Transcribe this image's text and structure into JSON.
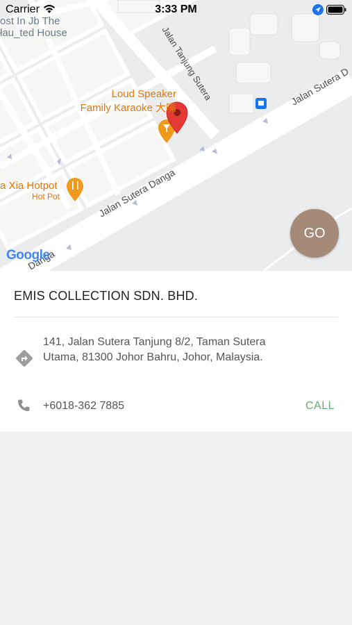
{
  "status_bar": {
    "carrier": "Carrier",
    "time": "3:33 PM"
  },
  "map": {
    "places": [
      {
        "line1": "ost In Jb The",
        "line2": "łau_ted House",
        "color": "#6b7a86"
      },
      {
        "line1": "Loud Speaker",
        "line2": "Family Karaoke 大嘴",
        "color": "#e0780f"
      },
      {
        "line1": "a Xia Hotpot",
        "line2": "Hot Pot",
        "color": "#e0780f"
      }
    ],
    "roads": [
      "Jalan Tanjung Sutera",
      "Jalan Sutera Danga",
      "Jalan Sutera D",
      "Danga"
    ],
    "attribution": "Google"
  },
  "go_button": {
    "label": "GO"
  },
  "location": {
    "name": "EMIS COLLECTION SDN. BHD.",
    "address": "141, Jalan Sutera Tanjung 8/2, Taman Sutera Utama, 81300 Johor Bahru, Johor, Malaysia.",
    "phone": "+6018-362 7885",
    "call_label": "CALL"
  },
  "colors": {
    "accent_go": "#a58a77",
    "call_green": "#6aa873",
    "marker_red": "#e53935"
  }
}
